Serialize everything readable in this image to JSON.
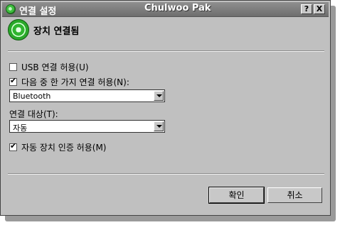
{
  "window": {
    "title": "연결 설정",
    "caption": "Chulwoo Pak",
    "help_label": "?",
    "close_label": "X"
  },
  "header": {
    "title": "장치 연결됨",
    "icon": "connected-device-icon"
  },
  "options": {
    "usb_label": "USB 연결 허용(U)",
    "usb_checked": false,
    "multi_label": "다음 중 한 가지 연결 허용(N):",
    "multi_checked": true,
    "connection_type_value": "Bluetooth",
    "target_label": "연결 대상(T):",
    "target_value": "자동",
    "auto_auth_label": "자동 장치 인증 허용(M)",
    "auto_auth_checked": true
  },
  "buttons": {
    "ok": "확인",
    "cancel": "취소"
  }
}
